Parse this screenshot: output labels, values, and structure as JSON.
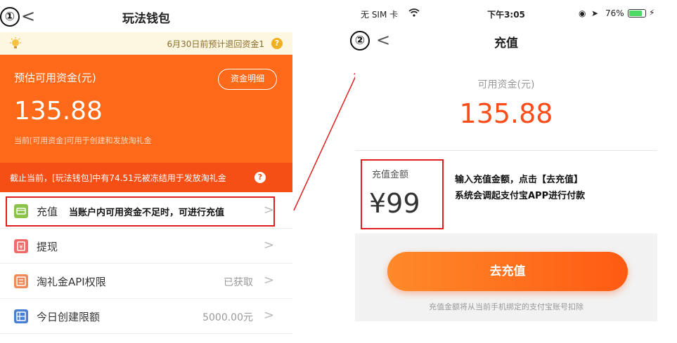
{
  "left": {
    "step_label": "①",
    "back_icon": "chevron-left-icon",
    "back_glyph": "<",
    "title": "玩法钱包",
    "notice": {
      "text": "6月30日前预计退回资金1",
      "help_glyph": "?"
    },
    "balance": {
      "label": "预估可用资金(元)",
      "detail_button": "资金明细",
      "amount": "135.88",
      "note": "当前[可用资金]可用于创建和发放淘礼金"
    },
    "frozen": {
      "text": "截止当前，[玩法钱包]中有74.51元被冻结用于发放淘礼金",
      "help_glyph": "?"
    },
    "menu": [
      {
        "label": "充值",
        "value": "",
        "icon": "recharge-icon",
        "icon_color": "#8bc34a"
      },
      {
        "label": "提现",
        "value": "",
        "icon": "withdraw-icon",
        "icon_color": "#f06a6a"
      },
      {
        "label": "淘礼金API权限",
        "value": "已获取",
        "icon": "api-icon",
        "icon_color": "#f08a5a"
      },
      {
        "label": "今日创建限额",
        "value": "5000.00元",
        "icon": "limit-icon",
        "icon_color": "#4a7fd4"
      }
    ],
    "chevron_glyph": ">",
    "recharge_annotation": "当账户内可用资金不足时，可进行充值"
  },
  "right": {
    "status_bar": {
      "carrier": "无 SIM 卡",
      "time": "下午3:05",
      "lock_glyph": "◉",
      "location_glyph": "➤",
      "battery": "76%",
      "charging_glyph": "⚡"
    },
    "step_label": "②",
    "back_glyph": "<",
    "title": "充值",
    "available_label": "可用资金(元)",
    "available_amount": "135.88",
    "amount_label": "充值金额",
    "amount_value": "¥99",
    "instruction_line1": "输入充值金额，点击【去充值】",
    "instruction_line2": "系统会调起支付宝APP进行付款",
    "recharge_button": "去充值",
    "deduct_note": "充值金额将从当前手机绑定的支付宝账号扣除"
  },
  "colors": {
    "orange": "#ff6a1a",
    "deep_orange": "#f54f15",
    "highlight_red": "#e02020"
  }
}
